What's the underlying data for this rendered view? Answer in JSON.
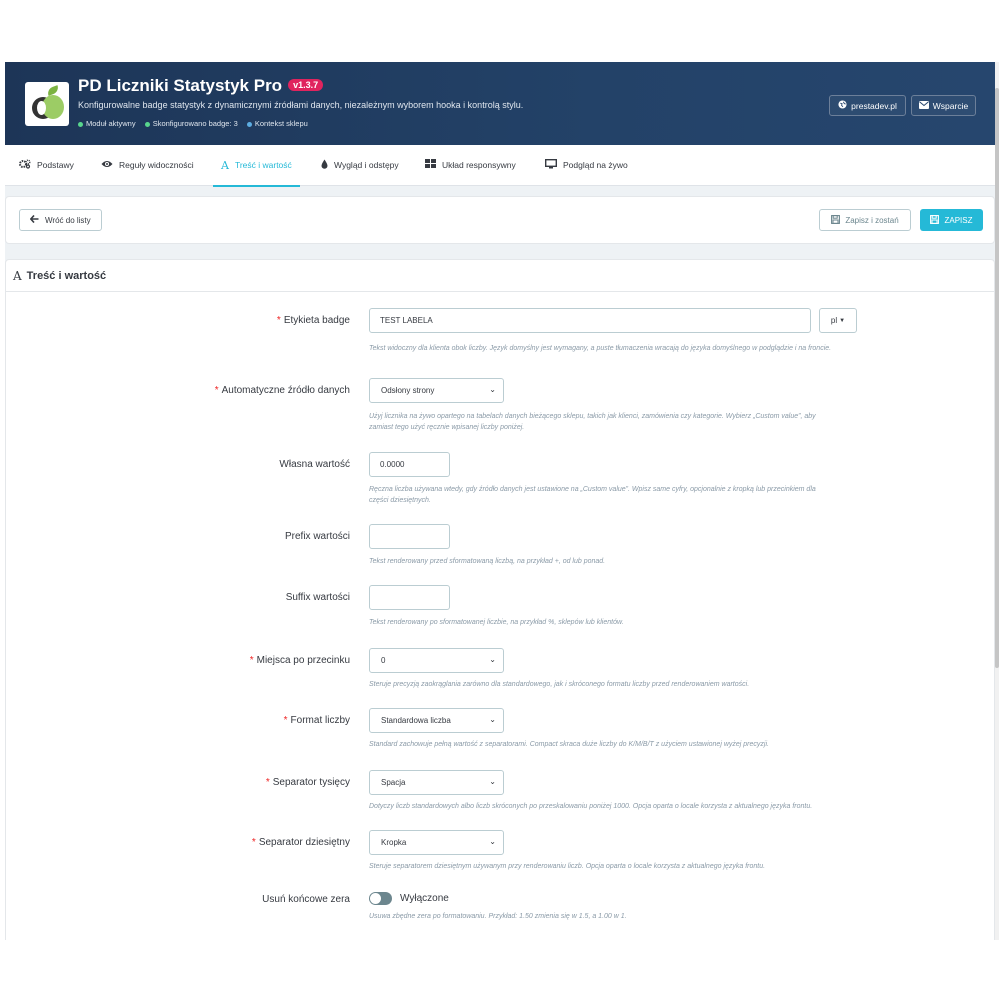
{
  "header": {
    "title": "PD Liczniki Statystyk Pro",
    "version": "v1.3.7",
    "description": "Konfigurowalne badge statystyk z dynamicznymi źródłami danych, niezależnym wyborem hooka i kontrolą stylu.",
    "status": [
      {
        "label": "Moduł aktywny",
        "color": "#58d68d"
      },
      {
        "label": "Skonfigurowano badge: 3",
        "color": "#58d68d"
      },
      {
        "label": "Kontekst sklepu",
        "color": "#5dade2"
      }
    ],
    "buttons": {
      "website": "prestadev.pl",
      "support": "Wsparcie"
    }
  },
  "tabs": [
    {
      "label": "Podstawy",
      "icon": "gears-icon"
    },
    {
      "label": "Reguły widoczności",
      "icon": "eye-icon"
    },
    {
      "label": "Treść i wartość",
      "icon": "text-icon",
      "active": true
    },
    {
      "label": "Wygląd i odstępy",
      "icon": "drop-icon"
    },
    {
      "label": "Układ responsywny",
      "icon": "grid-icon"
    },
    {
      "label": "Podgląd na żywo",
      "icon": "monitor-icon"
    }
  ],
  "toolbar": {
    "back_label": "Wróć do listy",
    "save_stay_label": "Zapisz i zostań",
    "save_label": "ZAPISZ"
  },
  "panel": {
    "title": "Treść i wartość",
    "fields": {
      "badge_label": {
        "label": "Etykieta badge",
        "value": "TEST LABELA",
        "lang": "pl",
        "help": "Tekst widoczny dla klienta obok liczby. Język domyślny jest wymagany, a puste tłumaczenia wracają do języka domyślnego w podglądzie i na froncie."
      },
      "data_source": {
        "label": "Automatyczne źródło danych",
        "value": "Odsłony strony",
        "help1": "Użyj licznika na żywo opartego na tabelach danych bieżącego sklepu, takich jak klienci, zamówienia czy kategorie. Wybierz „Custom value”, aby",
        "help2": "zamiast tego użyć ręcznie wpisanej liczby poniżej."
      },
      "custom_value": {
        "label": "Własna wartość",
        "value": "0.0000",
        "help1": "Ręczna liczba używana wtedy, gdy źródło danych jest ustawione na „Custom value”. Wpisz same cyfry, opcjonalnie z kropką lub przecinkiem dla",
        "help2": "części dziesiętnych."
      },
      "prefix": {
        "label": "Prefix wartości",
        "value": "",
        "help": "Tekst renderowany przed sformatowaną liczbą, na przykład +, od lub ponad."
      },
      "suffix": {
        "label": "Suffix wartości",
        "value": "",
        "help": "Tekst renderowany po sformatowanej liczbie, na przykład %, sklepów lub klientów."
      },
      "decimals": {
        "label": "Miejsca po przecinku",
        "value": "0",
        "help": "Steruje precyzją zaokrąglania zarówno dla standardowego, jak i skróconego formatu liczby przed renderowaniem wartości."
      },
      "number_format": {
        "label": "Format liczby",
        "value": "Standardowa liczba",
        "help": "Standard zachowuje pełną wartość z separatorami. Compact skraca duże liczby do K/M/B/T z użyciem ustawionej wyżej precyzji."
      },
      "thousands_sep": {
        "label": "Separator tysięcy",
        "value": "Spacja",
        "help": "Dotyczy liczb standardowych albo liczb skróconych po przeskalowaniu poniżej 1000. Opcja oparta o locale korzysta z aktualnego języka frontu."
      },
      "decimal_sep": {
        "label": "Separator dziesiętny",
        "value": "Kropka",
        "help": "Steruje separatorem dziesiętnym używanym przy renderowaniu liczb. Opcja oparta o locale korzysta z aktualnego języka frontu."
      },
      "trailing_zeros": {
        "label": "Usuń końcowe zera",
        "state": "Wyłączone",
        "help": "Usuwa zbędne zera po formatowaniu. Przykład: 1.50 zmienia się w 1.5, a 1.00 w 1."
      }
    }
  }
}
